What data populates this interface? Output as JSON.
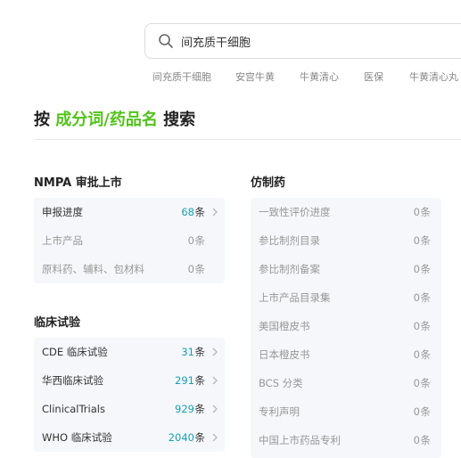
{
  "search": {
    "value": "间充质干细胞",
    "hot_words": [
      "间充质干细胞",
      "安宫牛黄",
      "牛黄清心",
      "医保",
      "牛黄清心丸"
    ]
  },
  "heading": {
    "prefix": "按",
    "accent": "成分词/药品名",
    "suffix": "搜索",
    "accent_color": "#52c41a"
  },
  "nmpa": {
    "title": "NMPA 审批上市",
    "rows": [
      {
        "label": "申报进度",
        "count": "68",
        "unit": "条"
      },
      {
        "label": "上市产品",
        "count": "0",
        "unit": "条"
      },
      {
        "label": "原料药、辅料、包材料",
        "count": "0",
        "unit": "条"
      }
    ]
  },
  "clinical": {
    "title": "临床试验",
    "rows": [
      {
        "label": "CDE 临床试验",
        "count": "31",
        "unit": "条"
      },
      {
        "label": "华西临床试验",
        "count": "291",
        "unit": "条"
      },
      {
        "label": "ClinicalTrials",
        "count": "929",
        "unit": "条"
      },
      {
        "label": "WHO 临床试验",
        "count": "2040",
        "unit": "条"
      }
    ]
  },
  "generic": {
    "title": "仿制药",
    "rows": [
      {
        "label": "一致性评价进度",
        "count": "0",
        "unit": "条"
      },
      {
        "label": "参比制剂目录",
        "count": "0",
        "unit": "条"
      },
      {
        "label": "参比制剂备案",
        "count": "0",
        "unit": "条"
      },
      {
        "label": "上市产品目录集",
        "count": "0",
        "unit": "条"
      },
      {
        "label": "美国橙皮书",
        "count": "0",
        "unit": "条"
      },
      {
        "label": "日本橙皮书",
        "count": "0",
        "unit": "条"
      },
      {
        "label": "BCS 分类",
        "count": "0",
        "unit": "条"
      },
      {
        "label": "专利声明",
        "count": "0",
        "unit": "条"
      },
      {
        "label": "中国上市药品专利",
        "count": "0",
        "unit": "条"
      }
    ]
  },
  "colors": {
    "count_active": "#1a9fb5",
    "card_bg": "#f5f7fa"
  }
}
